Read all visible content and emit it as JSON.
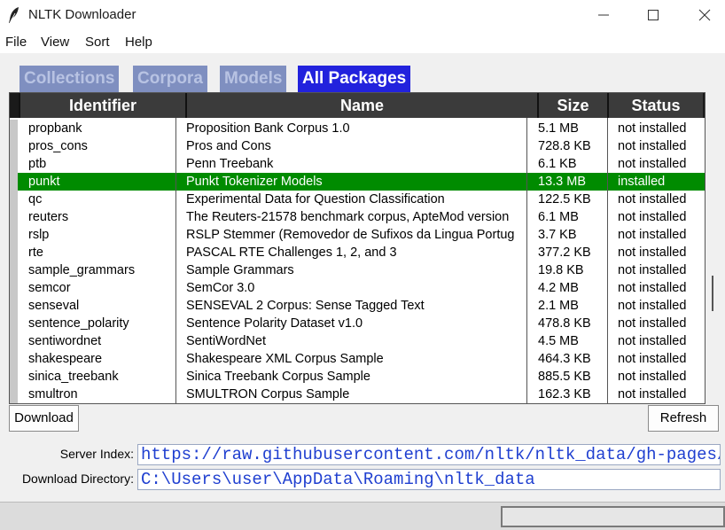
{
  "window": {
    "title": "NLTK Downloader",
    "icon": "feather-icon",
    "controls": [
      "minimize-icon",
      "maximize-icon",
      "close-icon"
    ]
  },
  "menu": [
    "File",
    "View",
    "Sort",
    "Help"
  ],
  "tabs": [
    {
      "label": "Collections",
      "active": false
    },
    {
      "label": "Corpora",
      "active": false
    },
    {
      "label": "Models",
      "active": false
    },
    {
      "label": "All Packages",
      "active": true
    }
  ],
  "table": {
    "headers": [
      "Identifier",
      "Name",
      "Size",
      "Status"
    ],
    "rows": [
      {
        "id": "propbank",
        "name": "Proposition Bank Corpus 1.0",
        "size": "5.1 MB",
        "status": "not installed"
      },
      {
        "id": "pros_cons",
        "name": "Pros and Cons",
        "size": "728.8 KB",
        "status": "not installed"
      },
      {
        "id": "ptb",
        "name": "Penn Treebank",
        "size": "6.1 KB",
        "status": "not installed"
      },
      {
        "id": "punkt",
        "name": "Punkt Tokenizer Models",
        "size": "13.3 MB",
        "status": "installed",
        "selected": true
      },
      {
        "id": "qc",
        "name": "Experimental Data for Question Classification",
        "size": "122.5 KB",
        "status": "not installed"
      },
      {
        "id": "reuters",
        "name": "The Reuters-21578 benchmark corpus, ApteMod version",
        "size": "6.1 MB",
        "status": "not installed"
      },
      {
        "id": "rslp",
        "name": "RSLP Stemmer (Removedor de Sufixos da Lingua Portug",
        "size": "3.7 KB",
        "status": "not installed"
      },
      {
        "id": "rte",
        "name": "PASCAL RTE Challenges 1, 2, and 3",
        "size": "377.2 KB",
        "status": "not installed"
      },
      {
        "id": "sample_grammars",
        "name": "Sample Grammars",
        "size": "19.8 KB",
        "status": "not installed"
      },
      {
        "id": "semcor",
        "name": "SemCor 3.0",
        "size": "4.2 MB",
        "status": "not installed"
      },
      {
        "id": "senseval",
        "name": "SENSEVAL 2 Corpus: Sense Tagged Text",
        "size": "2.1 MB",
        "status": "not installed"
      },
      {
        "id": "sentence_polarity",
        "name": "Sentence Polarity Dataset v1.0",
        "size": "478.8 KB",
        "status": "not installed"
      },
      {
        "id": "sentiwordnet",
        "name": "SentiWordNet",
        "size": "4.5 MB",
        "status": "not installed"
      },
      {
        "id": "shakespeare",
        "name": "Shakespeare XML Corpus Sample",
        "size": "464.3 KB",
        "status": "not installed"
      },
      {
        "id": "sinica_treebank",
        "name": "Sinica Treebank Corpus Sample",
        "size": "885.5 KB",
        "status": "not installed"
      },
      {
        "id": "smultron",
        "name": "SMULTRON Corpus Sample",
        "size": "162.3 KB",
        "status": "not installed"
      }
    ]
  },
  "buttons": {
    "download": "Download",
    "refresh": "Refresh"
  },
  "server_index": {
    "label": "Server Index:",
    "value": "https://raw.githubusercontent.com/nltk/nltk_data/gh-pages/index.xml"
  },
  "download_dir": {
    "label": "Download Directory:",
    "value": "C:\\Users\\user\\AppData\\Roaming\\nltk_data"
  },
  "progress": {
    "fraction": 0
  },
  "colors": {
    "selected_row": "#008b00",
    "active_tab": "#2222dd",
    "inactive_tab": "#7f8fc0",
    "url_text": "#1f3fd0"
  }
}
